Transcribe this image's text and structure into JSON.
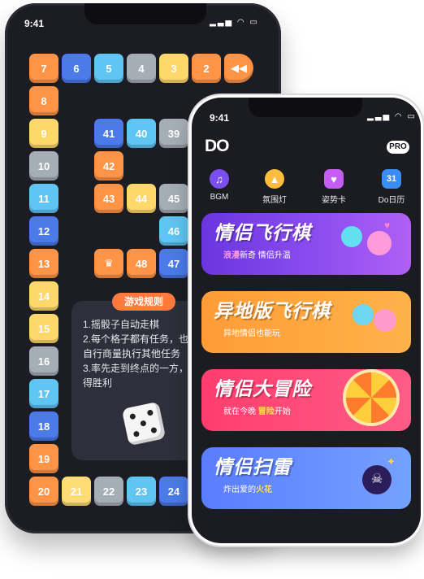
{
  "back_phone": {
    "time": "9:41",
    "board_tiles": [
      {
        "label": "7"
      },
      {
        "label": "6"
      },
      {
        "label": "5"
      },
      {
        "label": "4"
      },
      {
        "label": "3"
      },
      {
        "label": "2"
      },
      {
        "label": "8"
      },
      {
        "label": "9"
      },
      {
        "label": "10"
      },
      {
        "label": "11"
      },
      {
        "label": "12"
      },
      {
        "label": "13"
      },
      {
        "label": "14"
      },
      {
        "label": "15"
      },
      {
        "label": "16"
      },
      {
        "label": "17"
      },
      {
        "label": "18"
      },
      {
        "label": "19"
      },
      {
        "label": "20"
      },
      {
        "label": "21"
      },
      {
        "label": "22"
      },
      {
        "label": "23"
      },
      {
        "label": "24"
      },
      {
        "label": "41"
      },
      {
        "label": "40"
      },
      {
        "label": "39"
      },
      {
        "label": "42"
      },
      {
        "label": "43"
      },
      {
        "label": "44"
      },
      {
        "label": "45"
      },
      {
        "label": "46"
      },
      {
        "label": "48"
      },
      {
        "label": "47"
      }
    ],
    "rules": {
      "title": "游戏规则",
      "lines": [
        "1.摇骰子自动走棋",
        "2.每个格子都有任务，也",
        "自行商量执行其他任务",
        "3.率先走到终点的一方，",
        "得胜利"
      ]
    }
  },
  "front_phone": {
    "time": "9:41",
    "logo": "DO",
    "pro_badge": "PRO",
    "nav": [
      {
        "label": "BGM",
        "icon": "vinyl-music-icon"
      },
      {
        "label": "氛围灯",
        "icon": "lamp-icon"
      },
      {
        "label": "姿势卡",
        "icon": "heart-card-icon"
      },
      {
        "label": "Do日历",
        "icon": "calendar-icon",
        "icon_text": "31"
      }
    ],
    "cards": [
      {
        "title": "情侣飞行棋",
        "sub_highlight": "浪漫",
        "sub_text": "新奇 情侣升温",
        "color": "#7b3fe4"
      },
      {
        "title": "异地版飞行棋",
        "sub_text": "异地情侣也能玩",
        "color": "#ff9f3e"
      },
      {
        "title": "情侣大冒险",
        "sub_text_a": "就在今晚 ",
        "sub_highlight": "冒险",
        "sub_text_b": "开始",
        "color": "#ff4f7c"
      },
      {
        "title": "情侣扫雷",
        "sub_text_a": "炸出爱的",
        "sub_highlight": "火花",
        "color": "#6c8cff"
      }
    ]
  }
}
